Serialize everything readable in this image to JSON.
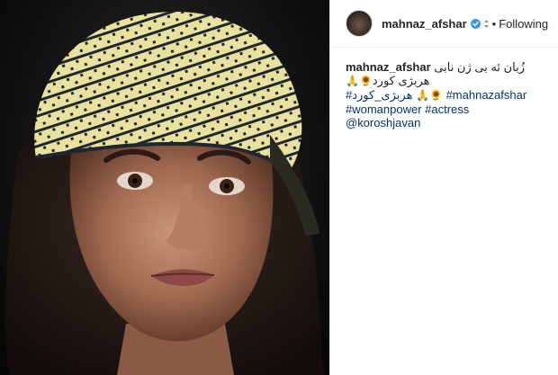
{
  "post": {
    "username": "mahnaz_afshar",
    "separator": "•",
    "follow_status": "Following",
    "caption": {
      "username": "mahnaz_afshar",
      "line1_text": "زُبان ئه بی ژن نابی",
      "line2_text": "هربژی کورد",
      "line2_emojis": "🙏🌻",
      "line3_tag_rtl": "#هربژی_کورد",
      "line3_emojis": "🙏🌻",
      "line3_tag": "#mahnazafshar",
      "line4_tags": "#womanpower #actress",
      "line5_mention": "@koroshjavan"
    }
  },
  "colors": {
    "link": "#003569",
    "verified": "#3897f0",
    "border": "#efefef",
    "scarf_light": "#e9e19e",
    "scarf_dark": "#1e2630"
  },
  "icons": {
    "verified": "verified-badge-icon"
  }
}
